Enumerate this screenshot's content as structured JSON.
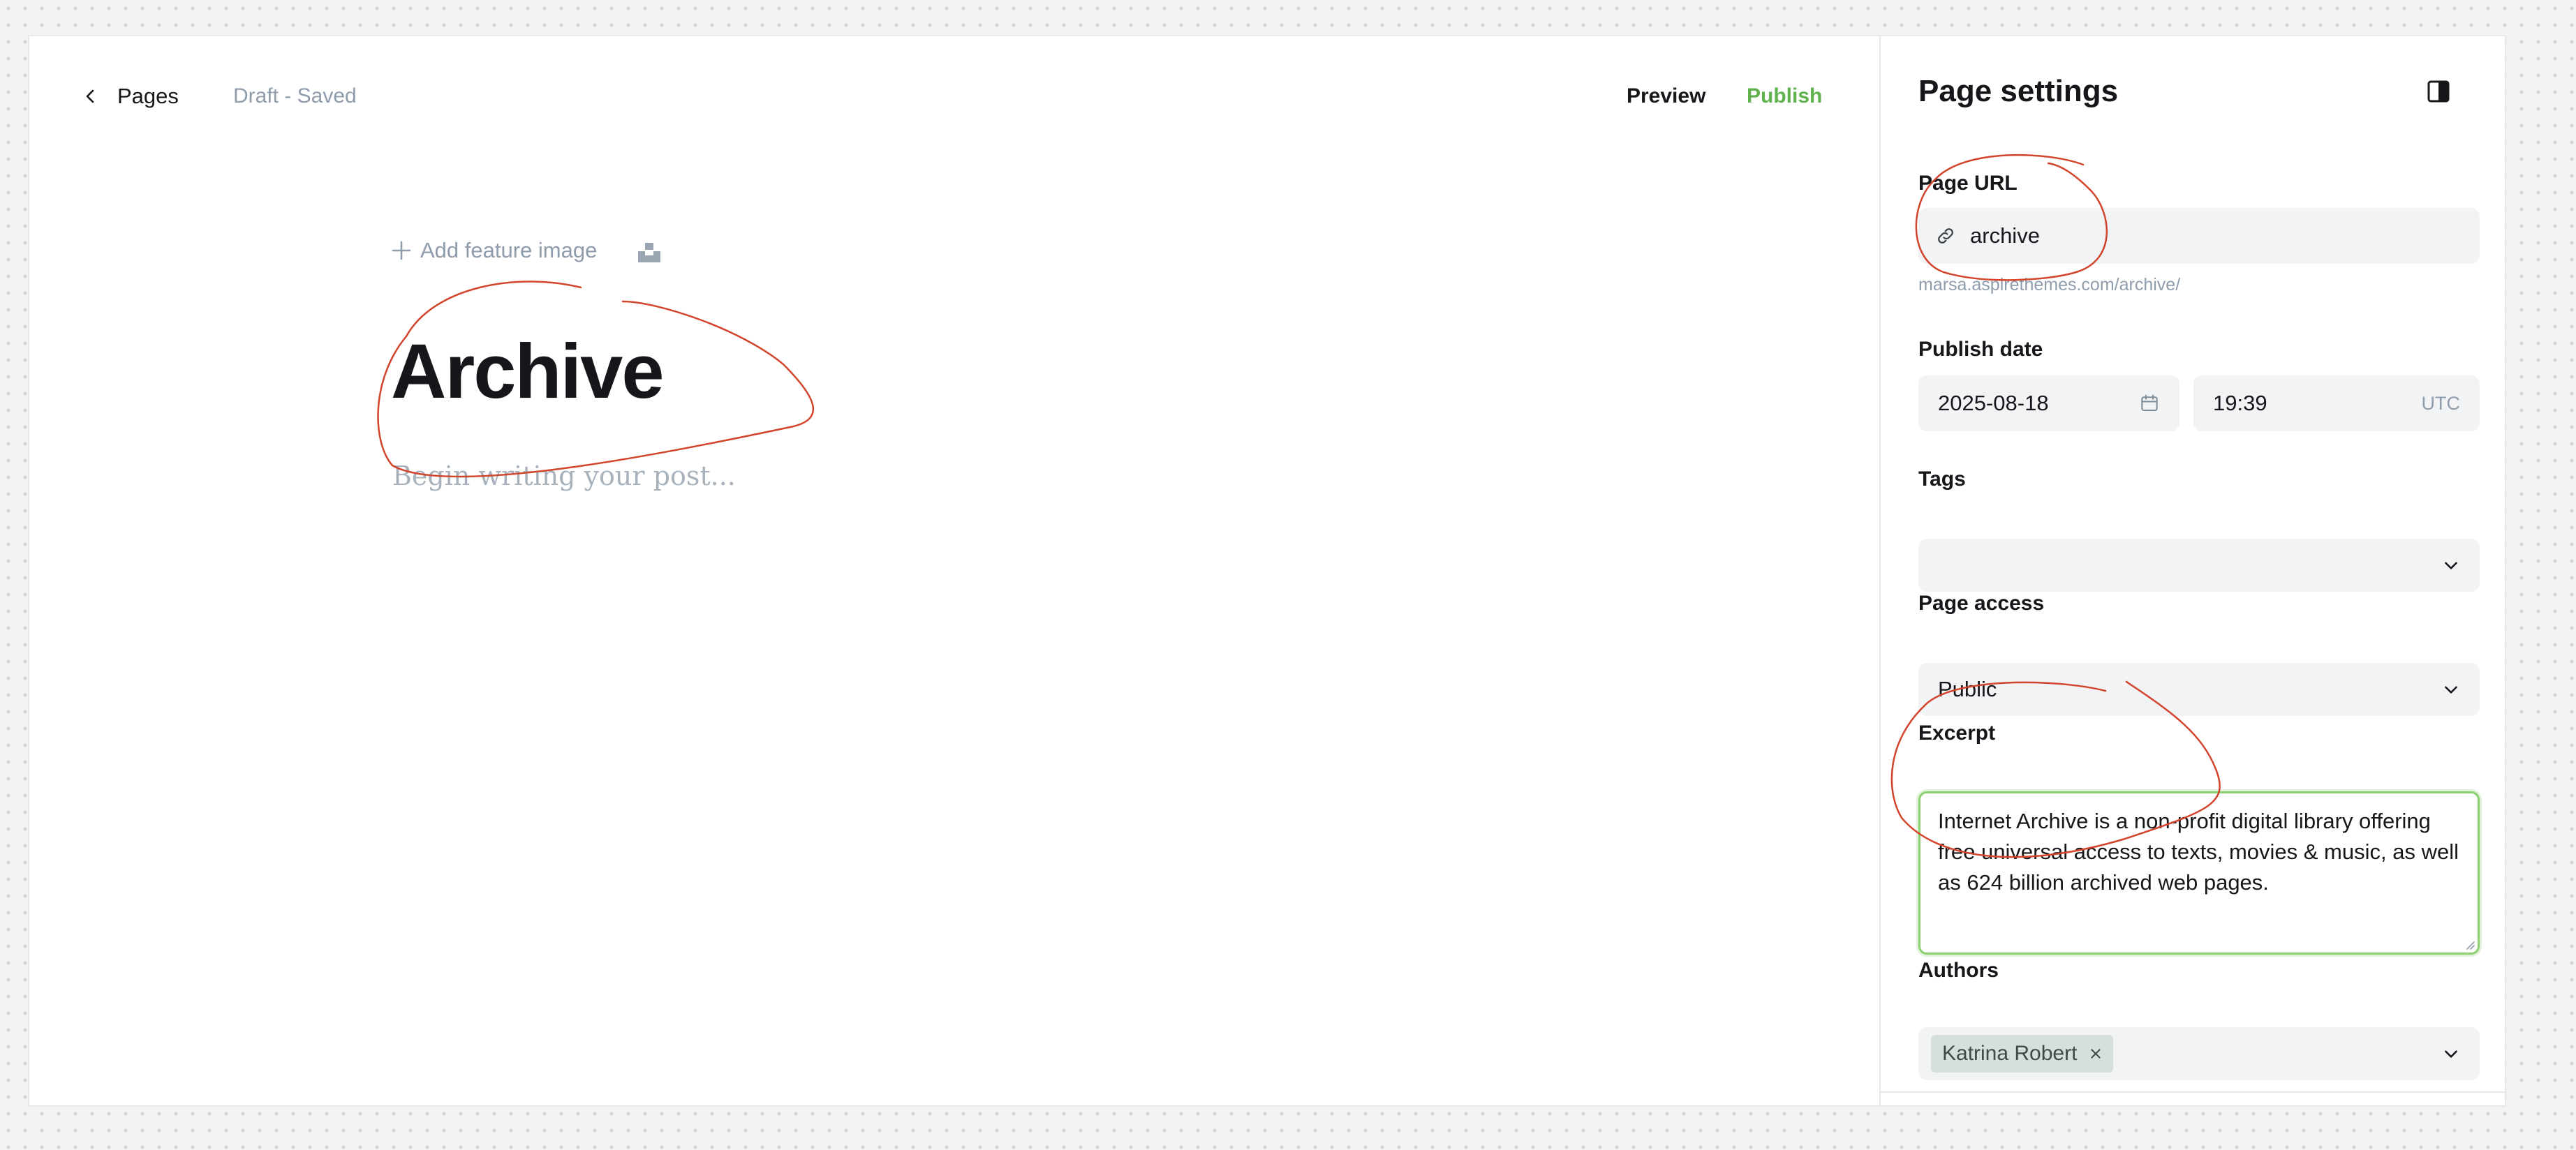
{
  "header": {
    "back_label": "Pages",
    "status": "Draft - Saved",
    "preview_label": "Preview",
    "publish_label": "Publish"
  },
  "editor": {
    "add_feature_image": "Add feature image",
    "title": "Archive",
    "body_placeholder": "Begin writing your post..."
  },
  "sidebar": {
    "title": "Page settings",
    "page_url": {
      "label": "Page URL",
      "value": "archive",
      "hint": "marsa.aspirethemes.com/archive/"
    },
    "publish_date": {
      "label": "Publish date",
      "date": "2025-08-18",
      "time": "19:39",
      "timezone": "UTC"
    },
    "tags": {
      "label": "Tags",
      "value": ""
    },
    "page_access": {
      "label": "Page access",
      "value": "Public"
    },
    "excerpt": {
      "label": "Excerpt",
      "value": "Internet Archive is a non-profit digital library offering free universal access to texts, movies & music, as well as 624 billion archived web pages."
    },
    "authors": {
      "label": "Authors",
      "items": [
        "Katrina Robert"
      ]
    }
  },
  "colors": {
    "publish": "#5fb24d",
    "muted_text": "#8e9cac",
    "field_background": "#f1f3f4",
    "excerpt_focus_border": "#8bd06f",
    "annotation_stroke": "#d2442c",
    "author_chip": "#d7dfdc"
  },
  "icons": {
    "back": "chevron-left-icon",
    "add": "plus-icon",
    "unsplash": "unsplash-icon",
    "panel": "sidebar-panel-icon",
    "url": "link-icon",
    "date": "calendar-icon",
    "dropdown": "chevron-down-icon",
    "remove": "close-icon"
  }
}
